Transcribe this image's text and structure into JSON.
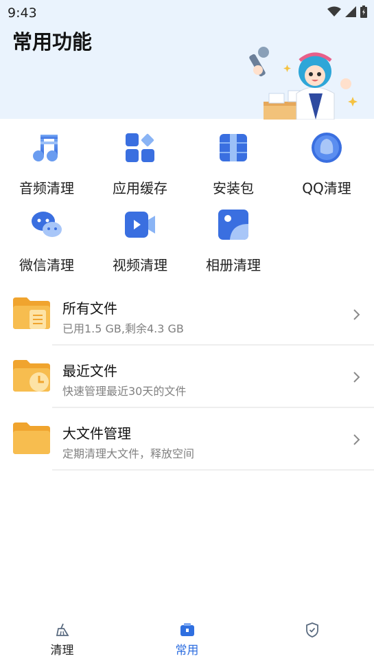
{
  "status_bar": {
    "time": "9:43"
  },
  "header": {
    "title": "常用功能"
  },
  "tools": [
    {
      "label": "音频清理",
      "icon": "music-note-icon"
    },
    {
      "label": "应用缓存",
      "icon": "app-grid-icon"
    },
    {
      "label": "安装包",
      "icon": "package-icon"
    },
    {
      "label": "QQ清理",
      "icon": "qq-penguin-icon"
    },
    {
      "label": "微信清理",
      "icon": "wechat-icon"
    },
    {
      "label": "视频清理",
      "icon": "video-camera-icon"
    },
    {
      "label": "相册清理",
      "icon": "photo-album-icon"
    }
  ],
  "files": [
    {
      "title": "所有文件",
      "subtitle": "已用1.5 GB,剩余4.3 GB",
      "icon": "folder-document-icon"
    },
    {
      "title": "最近文件",
      "subtitle": "快速管理最近30天的文件",
      "icon": "folder-clock-icon"
    },
    {
      "title": "大文件管理",
      "subtitle": "定期清理大文件，释放空间",
      "icon": "folder-icon"
    }
  ],
  "tabbar": {
    "tabs": [
      {
        "label": "清理",
        "active": false
      },
      {
        "label": "常用",
        "active": true
      },
      {
        "label": "",
        "active": false
      }
    ]
  },
  "colors": {
    "accent_blue": "#3a7cf0",
    "header_bg": "#eaf3fd",
    "folder_orange": "#f5b237",
    "active_tab": "#2f6fe0",
    "inactive_tab": "#222222"
  }
}
